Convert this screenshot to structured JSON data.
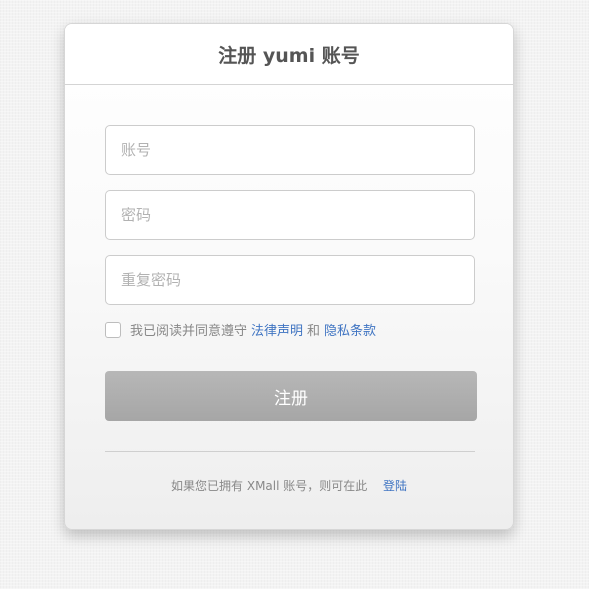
{
  "header": {
    "title": "注册 yumi 账号"
  },
  "form": {
    "username_placeholder": "账号",
    "password_placeholder": "密码",
    "repassword_placeholder": "重复密码",
    "username_value": "",
    "password_value": "",
    "repassword_value": "",
    "agree_checked": false,
    "agree_prefix": "我已阅读并同意遵守",
    "legal_link": "法律声明",
    "and_text": "和",
    "privacy_link": "隐私条款",
    "submit_label": "注册"
  },
  "footer": {
    "prompt": "如果您已拥有 XMall 账号，则可在此",
    "login_link": "登陆"
  },
  "colors": {
    "link": "#3f74c2",
    "button": "#aaaaaa",
    "muted_text": "#888888"
  }
}
